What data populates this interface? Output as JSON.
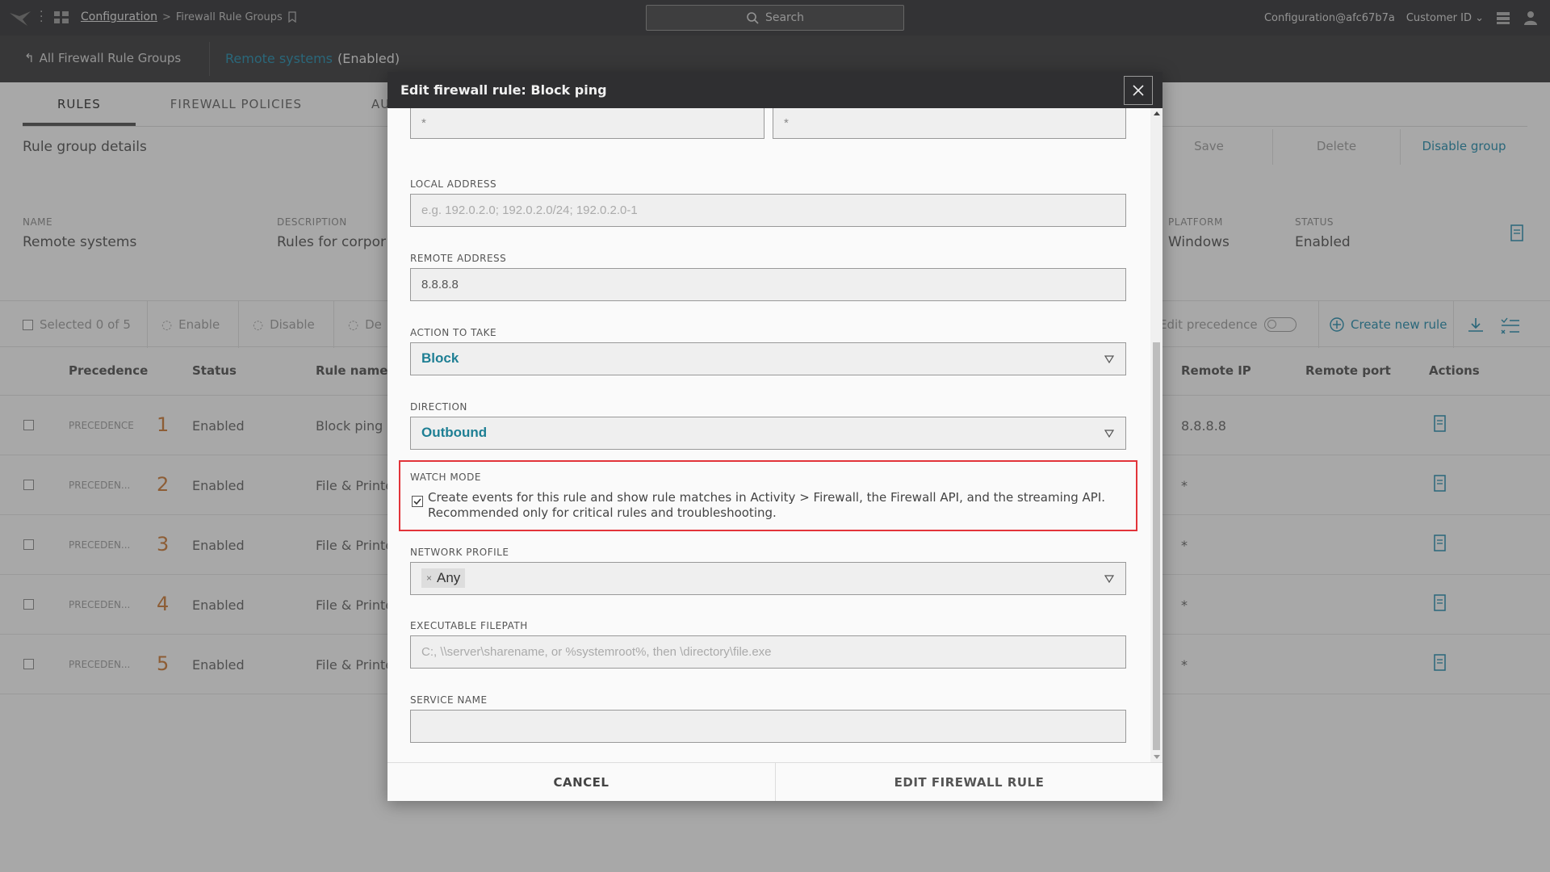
{
  "topbar": {
    "breadcrumb_root": "Configuration",
    "breadcrumb_current": "Firewall Rule Groups",
    "search_placeholder": "Search",
    "user": "Configuration@afc67b7a",
    "customer": "Customer ID"
  },
  "subbar": {
    "back_label": "All Firewall Rule Groups",
    "group_name": "Remote systems",
    "group_state": "(Enabled)"
  },
  "page": {
    "tabs": [
      "RULES",
      "FIREWALL POLICIES",
      "AU"
    ],
    "section_title": "Rule group details",
    "actions": {
      "save": "Save",
      "delete": "Delete",
      "disable_group": "Disable group"
    },
    "meta": {
      "name_label": "NAME",
      "name_value": "Remote systems",
      "desc_label": "DESCRIPTION",
      "desc_value": "Rules for corpor",
      "platform_label": "PLATFORM",
      "platform_value": "Windows",
      "status_label": "STATUS",
      "status_value": "Enabled"
    },
    "toolbar": {
      "selected": "Selected 0 of 5",
      "enable": "Enable",
      "disable": "Disable",
      "delete_short": "De",
      "edit_precedence": "Edit precedence",
      "create_rule": "Create new rule"
    },
    "columns": {
      "precedence": "Precedence",
      "status": "Status",
      "rule_name": "Rule name",
      "remote_ip": "Remote IP",
      "remote_port": "Remote port",
      "actions": "Actions"
    },
    "rows": [
      {
        "prec_label": "PRECEDENCE",
        "prec": "1",
        "status": "Enabled",
        "name": "Block ping",
        "remote_ip": "8.8.8.8"
      },
      {
        "prec_label": "PRECEDEN...",
        "prec": "2",
        "status": "Enabled",
        "name": "File & Printe",
        "remote_ip": "*"
      },
      {
        "prec_label": "PRECEDEN...",
        "prec": "3",
        "status": "Enabled",
        "name": "File & Printe",
        "remote_ip": "*"
      },
      {
        "prec_label": "PRECEDEN...",
        "prec": "4",
        "status": "Enabled",
        "name": "File & Printe",
        "remote_ip": "*"
      },
      {
        "prec_label": "PRECEDEN...",
        "prec": "5",
        "status": "Enabled",
        "name": "File & Printe",
        "remote_ip": "*"
      }
    ]
  },
  "modal": {
    "title": "Edit firewall rule: Block ping",
    "top_left_value": "*",
    "top_right_value": "*",
    "local_address": {
      "label": "LOCAL ADDRESS",
      "placeholder": "e.g. 192.0.2.0; 192.0.2.0/24; 192.0.2.0-1"
    },
    "remote_address": {
      "label": "REMOTE ADDRESS",
      "value": "8.8.8.8"
    },
    "action": {
      "label": "ACTION TO TAKE",
      "value": "Block"
    },
    "direction": {
      "label": "DIRECTION",
      "value": "Outbound"
    },
    "watch_mode": {
      "label": "WATCH MODE",
      "checked": true,
      "line1": "Create events for this rule and show rule matches in Activity > Firewall, the Firewall API, and the streaming API.",
      "line2": "Recommended only for critical rules and troubleshooting."
    },
    "network_profile": {
      "label": "NETWORK PROFILE",
      "chip_remove": "×",
      "chip": "Any"
    },
    "executable": {
      "label": "EXECUTABLE FILEPATH",
      "placeholder": "C:, \\\\server\\sharename, or %systemroot%, then \\directory\\file.exe"
    },
    "service_name": {
      "label": "SERVICE NAME",
      "value": ""
    },
    "cancel": "CANCEL",
    "submit": "EDIT FIREWALL RULE"
  },
  "colors": {
    "accent": "#2b89a6",
    "select_text": "#1e7f94",
    "highlight": "#e2343a",
    "precedence": "#c37a3c"
  }
}
